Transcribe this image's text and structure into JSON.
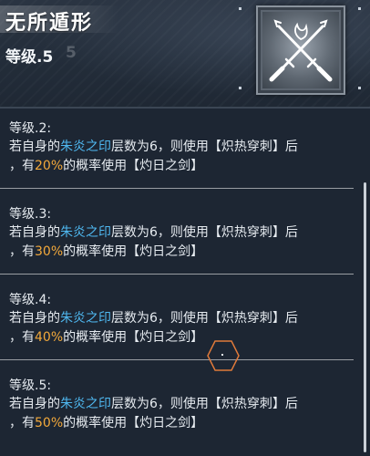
{
  "header": {
    "skill_name": "无所遁形",
    "current_level": "等级.5",
    "ghost_level": "5",
    "icon": "crossed-blades-icon"
  },
  "entries": [
    {
      "level": "等级.2:",
      "line1_pre": "若自身的",
      "keyword": "朱炎之印",
      "line1_post": "层数为6，则使用【炽热穿刺】后",
      "line2_pre": "，有",
      "chance": "20%",
      "line2_post": "的概率使用【灼日之剑】"
    },
    {
      "level": "等级.3:",
      "line1_pre": "若自身的",
      "keyword": "朱炎之印",
      "line1_post": "层数为6，则使用【炽热穿刺】后",
      "line2_pre": "，有",
      "chance": "30%",
      "line2_post": "的概率使用【灼日之剑】"
    },
    {
      "level": "等级.4:",
      "line1_pre": "若自身的",
      "keyword": "朱炎之印",
      "line1_post": "层数为6，则使用【炽热穿刺】后",
      "line2_pre": "，有",
      "chance": "40%",
      "line2_post": "的概率使用【灼日之剑】"
    },
    {
      "level": "等级.5:",
      "line1_pre": "若自身的",
      "keyword": "朱炎之印",
      "line1_post": "层数为6，则使用【炽热穿刺】后",
      "line2_pre": "，有",
      "chance": "50%",
      "line2_post": "的概率使用【灼日之剑】"
    }
  ],
  "colors": {
    "keyword": "#4fb8f0",
    "chance": "#f3a93b",
    "cursor": "#e07a3a"
  }
}
